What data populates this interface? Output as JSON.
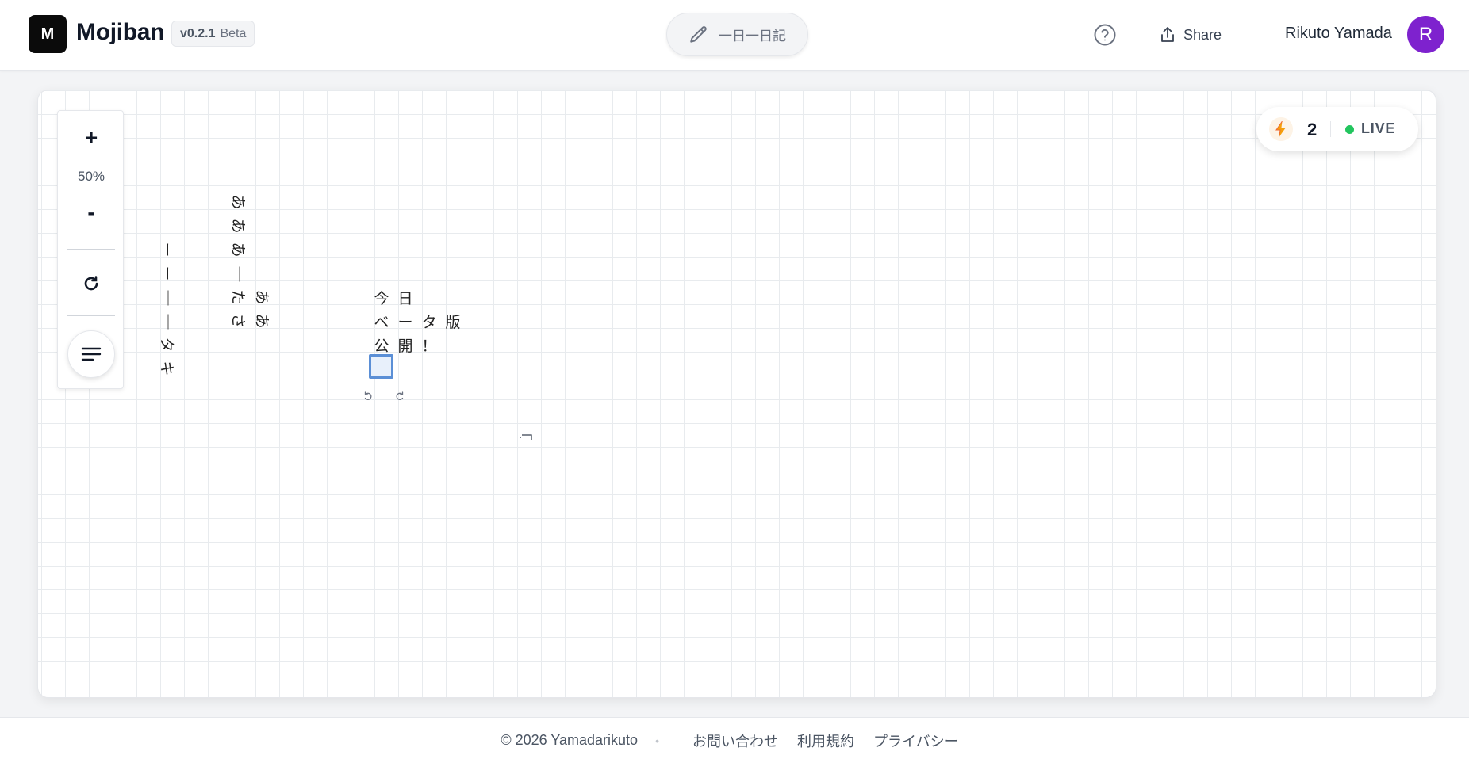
{
  "header": {
    "logo_letter": "M",
    "brand": "Mojiban",
    "version": "v0.2.1",
    "beta": "Beta",
    "topic": "一日一日記",
    "share_label": "Share",
    "user_name": "Rikuto Yamada",
    "avatar_letter": "R"
  },
  "zoom": {
    "plus": "+",
    "level": "50%",
    "minus": "-"
  },
  "live": {
    "count": "2",
    "label": "LIVE"
  },
  "board": {
    "col1": [
      "ー",
      "ー",
      "｜",
      "｜",
      "タ",
      "キ"
    ],
    "col2": [
      "あ",
      "あ",
      "あ",
      "｜",
      "た",
      "さ"
    ],
    "col3": [
      "あ",
      "あ"
    ],
    "row1": [
      "今",
      "日"
    ],
    "row2": [
      "ベ",
      "ー",
      "タ",
      "版"
    ],
    "row3": [
      "公",
      "開",
      "！"
    ]
  },
  "footer": {
    "copyright": "© 2026 Yamadarikuto",
    "dot": "•",
    "contact": "お問い合わせ",
    "terms": "利用規約",
    "privacy": "プライバシー"
  },
  "colors": {
    "accent_avatar": "#7e22ce",
    "live_green": "#22c55e",
    "cursor_blue": "#5b8fd6",
    "bolt_orange": "#f59e0b"
  },
  "icons": [
    "pencil-icon",
    "help-icon",
    "share-icon",
    "reset-icon",
    "menu-icon",
    "bolt-icon",
    "undo-icon",
    "redo-icon"
  ]
}
